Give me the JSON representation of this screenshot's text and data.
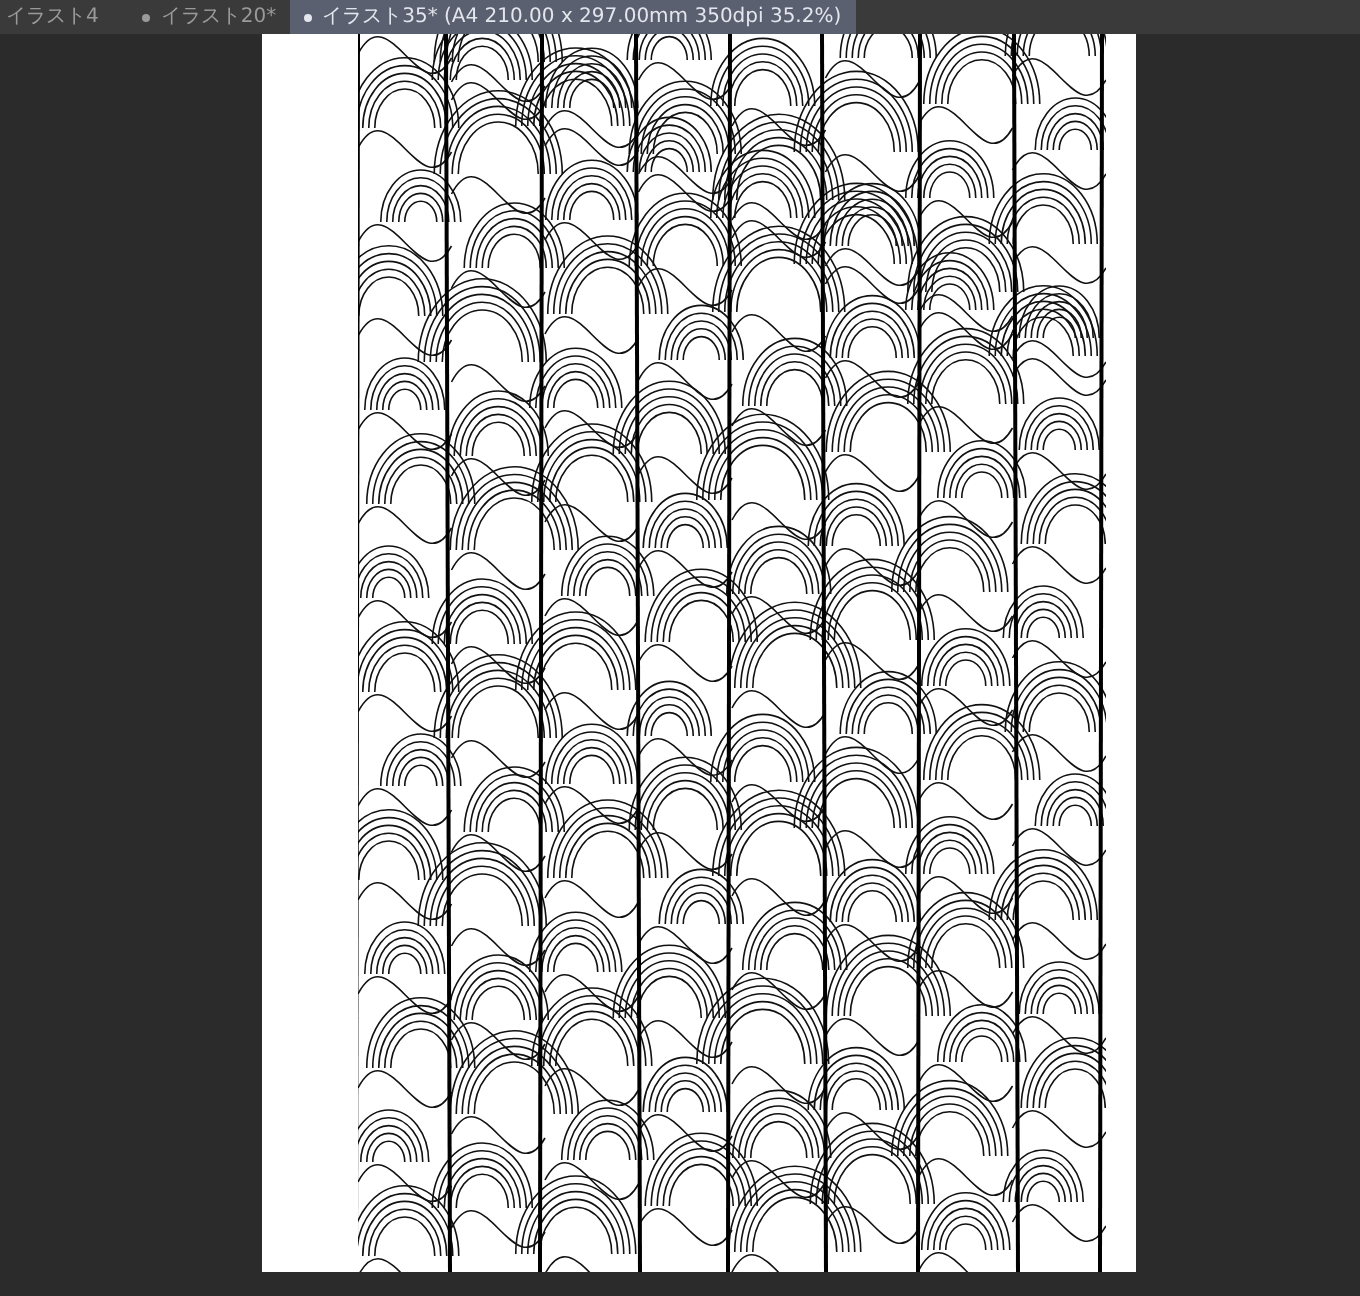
{
  "tabs": [
    {
      "label": "イラスト4",
      "modified": false,
      "selected": false
    },
    {
      "label": "イラスト20*",
      "modified": true,
      "selected": false
    },
    {
      "label": "イラスト35* (A4 210.00 x 297.00mm 350dpi 35.2%)",
      "modified": true,
      "selected": true
    }
  ]
}
